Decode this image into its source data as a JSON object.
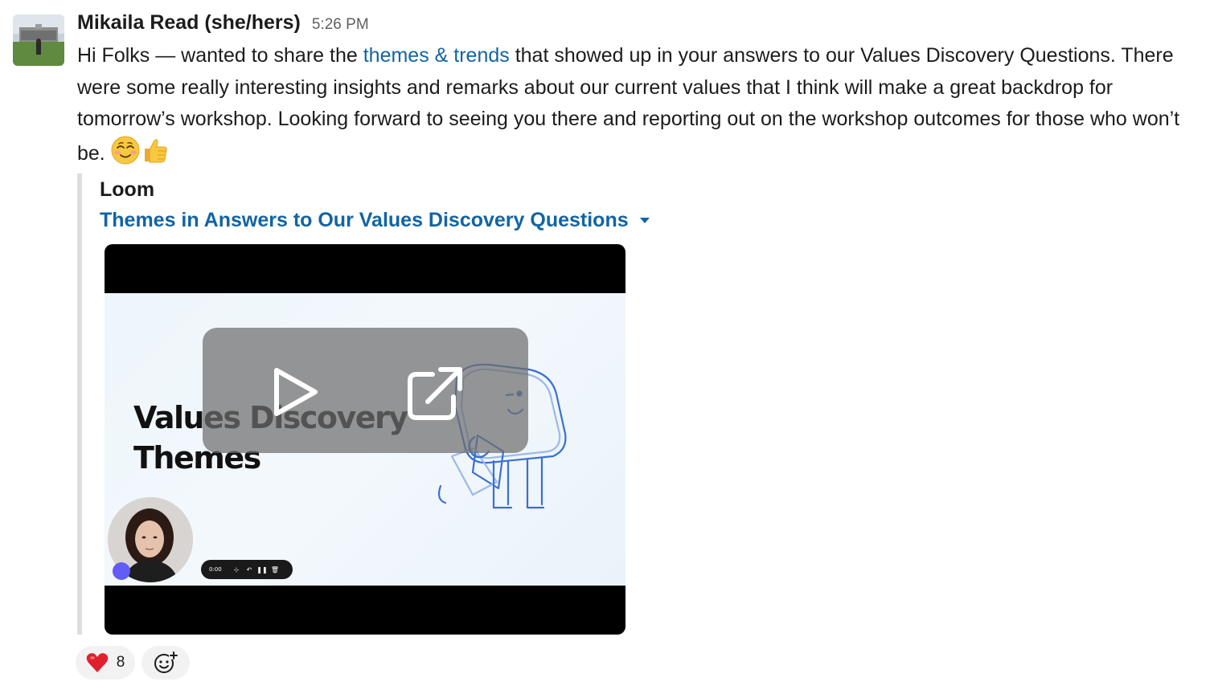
{
  "message": {
    "sender": "Mikaila Read (she/hers)",
    "timestamp": "5:26 PM",
    "text_before_link": "Hi Folks — wanted to share the ",
    "link_text": "themes & trends",
    "text_after_link": " that showed up in your answers to our Values Discovery Questions. There were some really interesting insights and remarks about our current values that I think will make a great backdrop for tomorrow’s workshop. Looking forward to seeing you there and reporting out on the workshop outcomes for those who won’t be. ",
    "emojis": [
      "relieved-smile-emoji",
      "thumbs-up-emoji"
    ]
  },
  "attachment": {
    "service": "Loom",
    "title": "Themes in Answers to Our Values Discovery Questions",
    "video": {
      "slide_title_line1": "Values Discovery",
      "slide_title_line2": "Themes",
      "time": "0:00"
    }
  },
  "reactions": [
    {
      "emoji": "heart-emoji",
      "count": "8"
    },
    {
      "emoji": "add-reaction-icon"
    }
  ],
  "colors": {
    "link": "#1264a3",
    "text": "#1d1c1d",
    "muted": "#616061",
    "attachment_bar": "#dddddd",
    "reaction_bg": "#f2f2f2"
  }
}
